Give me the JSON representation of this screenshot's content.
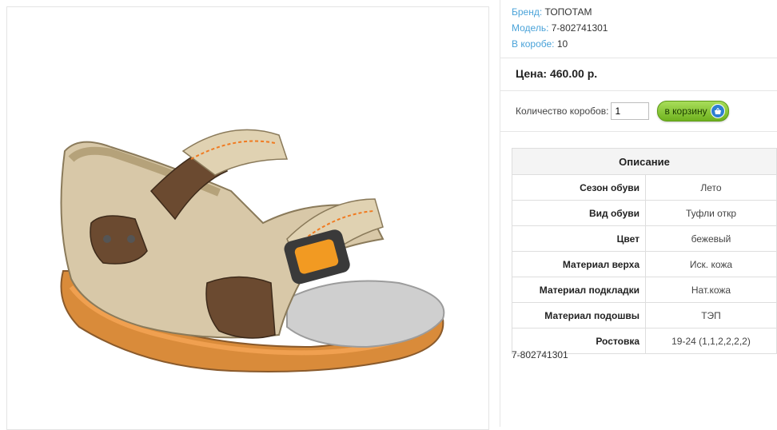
{
  "product": {
    "brand_label": "Бренд:",
    "brand": "ТОПОТАМ",
    "model_label": "Модель:",
    "model": "7-802741301",
    "box_label": "В коробе:",
    "box_count": "10",
    "price_label": "Цена:",
    "price": "460.00 р.",
    "qty_label": "Количество коробов:",
    "qty_value": "1",
    "cart_label": "в корзину",
    "sku": "7-802741301"
  },
  "specs": {
    "title": "Описание",
    "rows": [
      {
        "key": "Сезон обуви",
        "value": "Лето"
      },
      {
        "key": "Вид обуви",
        "value": "Туфли откр"
      },
      {
        "key": "Цвет",
        "value": "бежевый"
      },
      {
        "key": "Материал верха",
        "value": "Иск. кожа"
      },
      {
        "key": "Материал подкладки",
        "value": "Нат.кожа"
      },
      {
        "key": "Материал подошвы",
        "value": "ТЭП"
      },
      {
        "key": "Ростовка",
        "value": "19-24 (1,1,2,2,2,2)"
      }
    ]
  },
  "icons": {
    "cart": "basket-icon",
    "product_image": "sandal-image"
  },
  "colors": {
    "link": "#4aa3d9",
    "button_green": "#7fc22e",
    "border": "#dedede"
  }
}
